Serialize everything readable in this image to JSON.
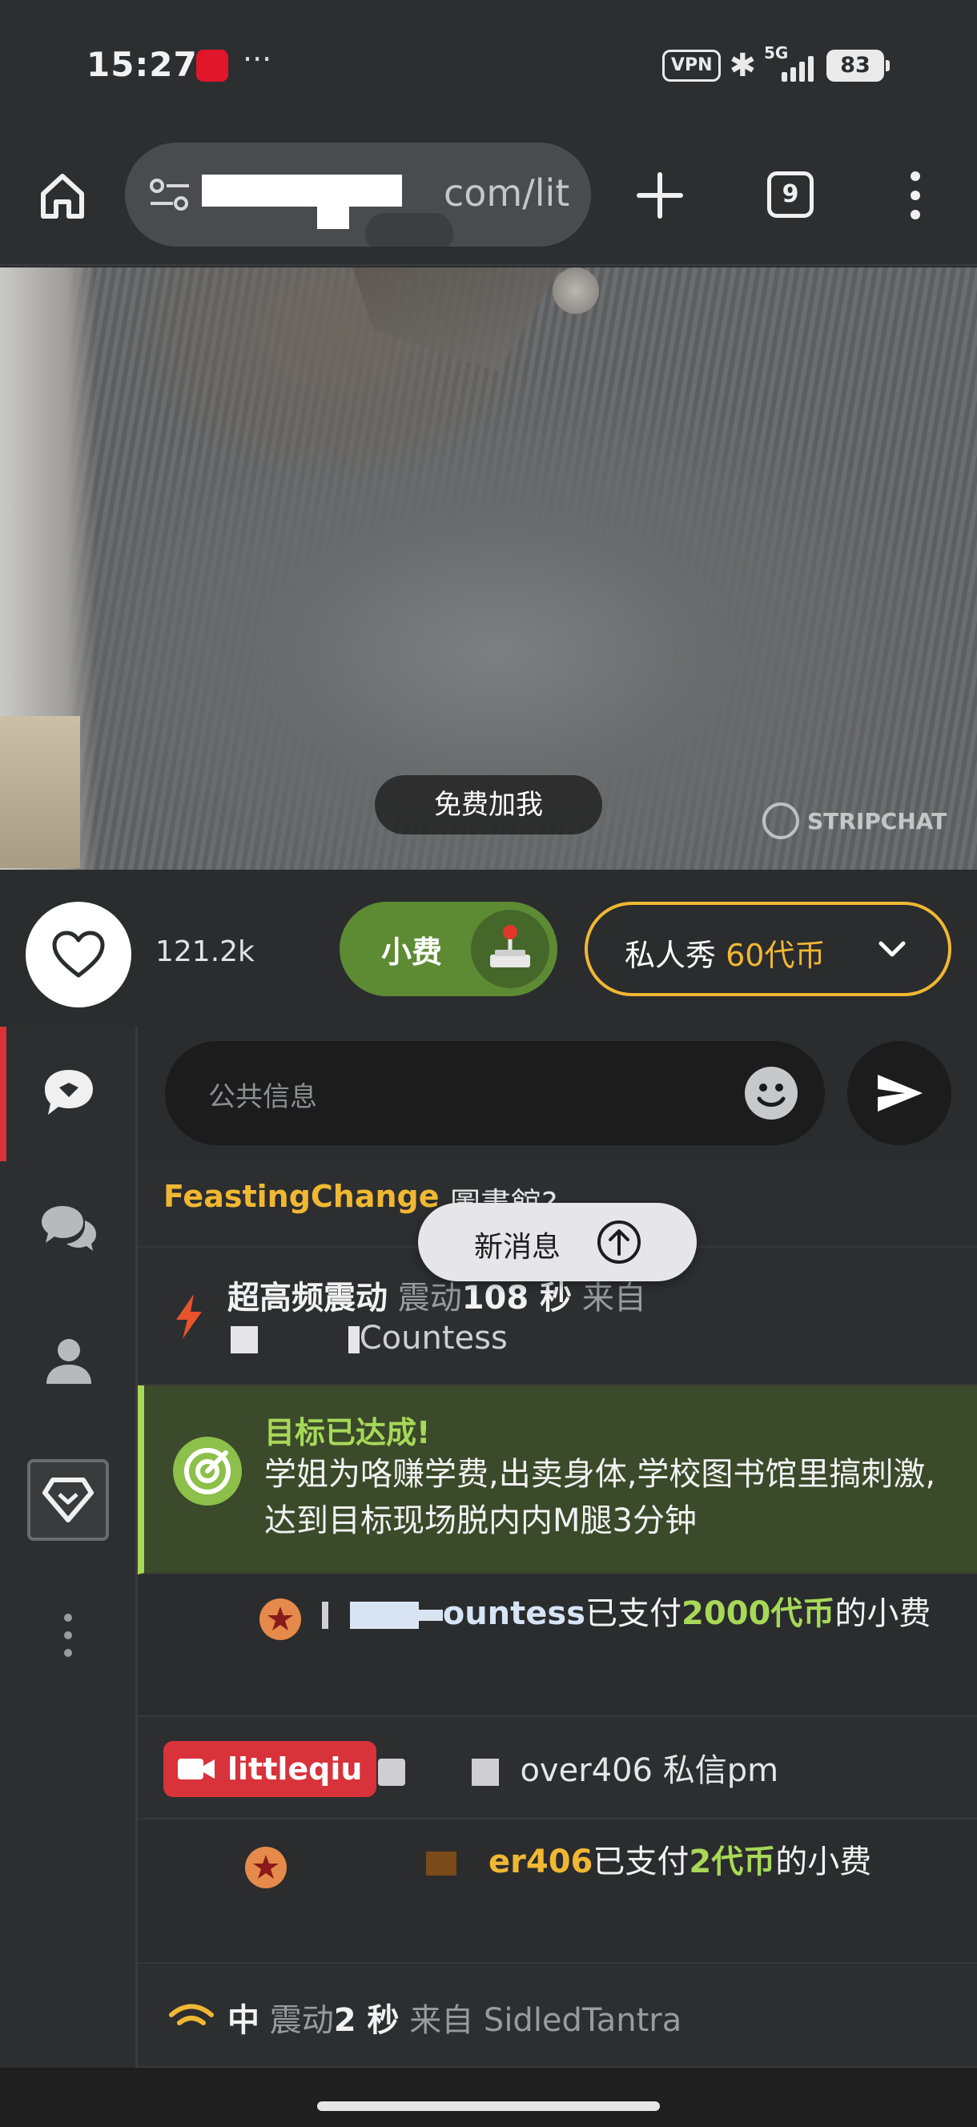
{
  "status_bar": {
    "time": "15:27",
    "more": "···",
    "vpn": "VPN",
    "network": "5G",
    "battery": "83"
  },
  "browser": {
    "url_visible": "com/lit",
    "tab_count": "9"
  },
  "video": {
    "overlay_button": "免费加我",
    "watermark": "STRIPCHAT"
  },
  "actions": {
    "like_count": "121.2k",
    "tip_label": "小费",
    "private_label": "私人秀",
    "private_price": "60代币"
  },
  "chat": {
    "input_placeholder": "公共信息",
    "new_messages": "新消息",
    "messages": {
      "m1": {
        "user": "FeastingChange",
        "text": "圖書館?"
      },
      "m2": {
        "title": "超高频震动",
        "verb": "震动",
        "duration": "108 秒",
        "from": "来自",
        "user_suffix": "Countess"
      },
      "goal": {
        "title": "目标已达成!",
        "description": "学姐为咯赚学费,出卖身体,学校图书馆里搞刺激,达到目标现场脱内内M腿3分钟"
      },
      "m4": {
        "user_suffix": "ountess",
        "paid": "已支付",
        "amount": "2000代币",
        "tail": "的小费"
      },
      "m5": {
        "badge_user": "littleqiu",
        "text": "over406 私信pm"
      },
      "m6": {
        "user_suffix": "er406",
        "paid": "已支付",
        "amount": "2代币",
        "tail": "的小费"
      },
      "m7": {
        "level": "中",
        "verb": "震动",
        "duration": "2 秒",
        "from": "来自",
        "user": "SidledTantra"
      }
    }
  },
  "colors": {
    "accent_red": "#d8323b",
    "tip_green": "#5d8b34",
    "gold": "#f0b832",
    "goal_green": "#a7d858"
  },
  "icons": [
    "home-icon",
    "site-settings-icon",
    "plus-icon",
    "tabs-icon",
    "overflow-menu-icon",
    "heart-icon",
    "joystick-icon",
    "chevron-down-icon",
    "chat-bubble-icon",
    "group-chat-icon",
    "user-icon",
    "diamond-icon",
    "more-vertical-icon",
    "emoji-icon",
    "send-icon",
    "arrow-up-icon",
    "bolt-icon",
    "target-icon",
    "star-icon",
    "camera-icon",
    "vibration-wave-icon"
  ]
}
